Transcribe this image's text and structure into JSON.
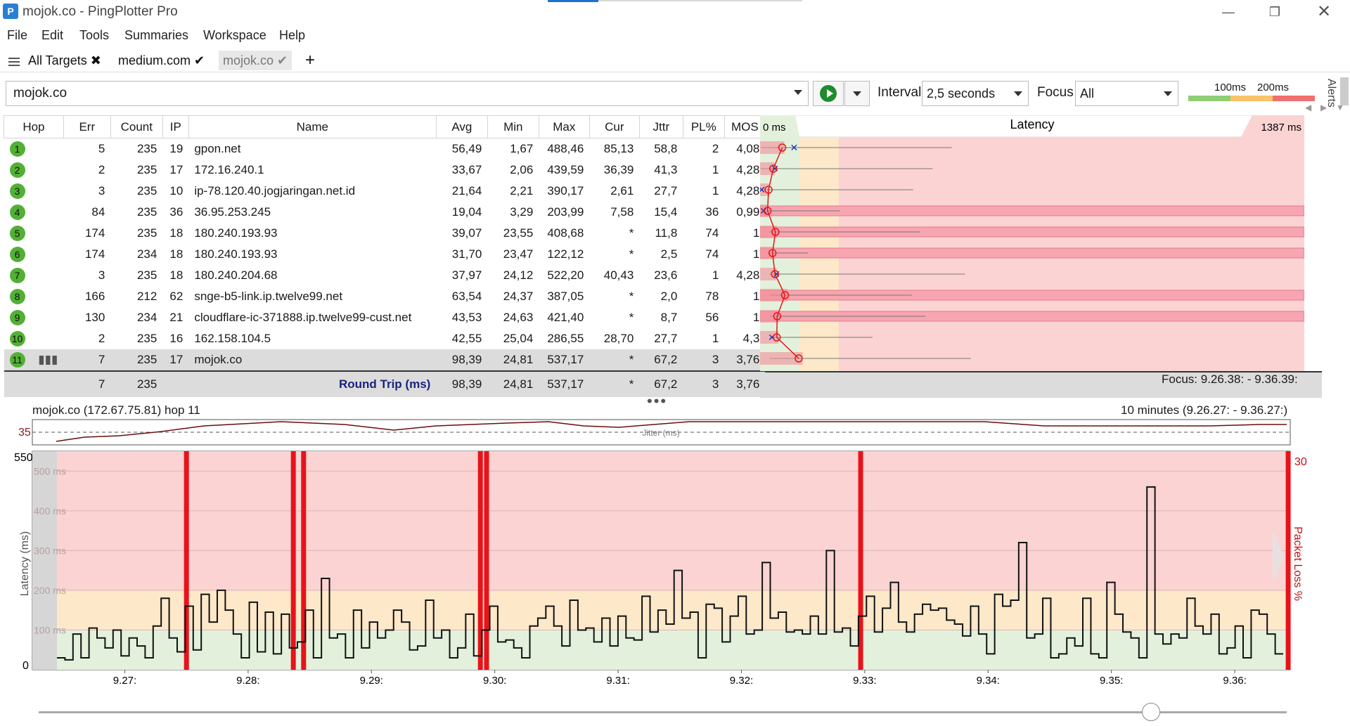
{
  "window": {
    "title": "mojok.co - PingPlotter Pro",
    "minimize_icon": "minimize-icon",
    "restore_icon": "restore-icon",
    "close_icon": "close-icon"
  },
  "menu": [
    "File",
    "Edit",
    "Tools",
    "Summaries",
    "Workspace",
    "Help"
  ],
  "tabs": [
    {
      "label": "All Targets",
      "icon": "close-x-icon"
    },
    {
      "label": "medium.com",
      "icon": "check-icon"
    },
    {
      "label": "mojok.co",
      "icon": "check-icon",
      "active": true
    }
  ],
  "toolbar": {
    "target_value": "mojok.co",
    "interval_label": "Interval",
    "interval_value": "2,5 seconds",
    "focus_label": "Focus",
    "focus_value": "All",
    "legend_100": "100ms",
    "legend_200": "200ms",
    "alerts_label": "Alerts",
    "colors": {
      "good": "#8fce74",
      "warn": "#f9c36b",
      "bad": "#f26f6f"
    }
  },
  "table": {
    "headers": [
      "Hop",
      "Err",
      "Count",
      "IP",
      "Name",
      "Avg",
      "Min",
      "Max",
      "Cur",
      "Jttr",
      "PL%",
      "MOS"
    ],
    "latency_header": "Latency",
    "latency_min_label": "0 ms",
    "latency_max_label": "1387 ms",
    "rows": [
      {
        "hop": "1",
        "err": "5",
        "count": "235",
        "ip": "19",
        "name": "gpon.net",
        "avg": "56,49",
        "min": "1,67",
        "max": "488,46",
        "cur": "85,13",
        "jttr": "58,8",
        "pl": "2",
        "mos": "4,08"
      },
      {
        "hop": "2",
        "err": "2",
        "count": "235",
        "ip": "17",
        "name": "172.16.240.1",
        "avg": "33,67",
        "min": "2,06",
        "max": "439,59",
        "cur": "36,39",
        "jttr": "41,3",
        "pl": "1",
        "mos": "4,28"
      },
      {
        "hop": "3",
        "err": "3",
        "count": "235",
        "ip": "10",
        "name": "ip-78.120.40.jogjaringan.net.id",
        "avg": "21,64",
        "min": "2,21",
        "max": "390,17",
        "cur": "2,61",
        "jttr": "27,7",
        "pl": "1",
        "mos": "4,28"
      },
      {
        "hop": "4",
        "err": "84",
        "count": "235",
        "ip": "36",
        "name": "36.95.253.245",
        "avg": "19,04",
        "min": "3,29",
        "max": "203,99",
        "cur": "7,58",
        "jttr": "15,4",
        "pl": "36",
        "mos": "0,99"
      },
      {
        "hop": "5",
        "err": "174",
        "count": "235",
        "ip": "18",
        "name": "180.240.193.93",
        "avg": "39,07",
        "min": "23,55",
        "max": "408,68",
        "cur": "*",
        "jttr": "11,8",
        "pl": "74",
        "mos": "1"
      },
      {
        "hop": "6",
        "err": "174",
        "count": "234",
        "ip": "18",
        "name": "180.240.193.93",
        "avg": "31,70",
        "min": "23,47",
        "max": "122,12",
        "cur": "*",
        "jttr": "2,5",
        "pl": "74",
        "mos": "1"
      },
      {
        "hop": "7",
        "err": "3",
        "count": "235",
        "ip": "18",
        "name": "180.240.204.68",
        "avg": "37,97",
        "min": "24,12",
        "max": "522,20",
        "cur": "40,43",
        "jttr": "23,6",
        "pl": "1",
        "mos": "4,28"
      },
      {
        "hop": "8",
        "err": "166",
        "count": "212",
        "ip": "62",
        "name": "snge-b5-link.ip.twelve99.net",
        "avg": "63,54",
        "min": "24,37",
        "max": "387,05",
        "cur": "*",
        "jttr": "2,0",
        "pl": "78",
        "mos": "1"
      },
      {
        "hop": "9",
        "err": "130",
        "count": "234",
        "ip": "21",
        "name": "cloudflare-ic-371888.ip.twelve99-cust.net",
        "avg": "43,53",
        "min": "24,63",
        "max": "421,40",
        "cur": "*",
        "jttr": "8,7",
        "pl": "56",
        "mos": "1"
      },
      {
        "hop": "10",
        "err": "2",
        "count": "235",
        "ip": "16",
        "name": "162.158.104.5",
        "avg": "42,55",
        "min": "25,04",
        "max": "286,55",
        "cur": "28,70",
        "jttr": "27,7",
        "pl": "1",
        "mos": "4,3"
      },
      {
        "hop": "11",
        "err": "7",
        "count": "235",
        "ip": "17",
        "name": "mojok.co",
        "avg": "98,39",
        "min": "24,81",
        "max": "537,17",
        "cur": "*",
        "jttr": "67,2",
        "pl": "3",
        "mos": "3,76",
        "selected": true,
        "icon": "bar-chart-icon"
      }
    ],
    "summary": {
      "err": "7",
      "count": "235",
      "name": "Round Trip (ms)",
      "avg": "98,39",
      "min": "24,81",
      "max": "537,17",
      "cur": "*",
      "jttr": "67,2",
      "pl": "3",
      "mos": "3,76",
      "focus": "Focus: 9.26.38: - 9.36.39:"
    }
  },
  "bottom": {
    "target_label": "mojok.co (172.67.75.81) hop 11",
    "range_label": "10 minutes (9.26.27: - 9.36.27:)",
    "jitter_label": "Jitter (ms)",
    "jitter_max": "35",
    "y_max": "550",
    "y_min": "0",
    "y_axis_label": "Latency (ms)",
    "right_axis_label": "Packet Loss %",
    "right_axis_max": "30",
    "band_labels": [
      "500 ms",
      "400 ms",
      "300 ms",
      "200 ms",
      "100 ms"
    ]
  },
  "chart_data": {
    "type": "line",
    "title": "",
    "xlabel": "",
    "ylabel": "Latency (ms)",
    "ylim": [
      0,
      550
    ],
    "x_ticks": [
      "9.27:",
      "9.28:",
      "9.29:",
      "9.30:",
      "9.31:",
      "9.32:",
      "9.33:",
      "9.34:",
      "9.35:",
      "9.36:"
    ],
    "y_ticks": [
      0,
      550
    ],
    "series": [
      {
        "values": [
          30,
          25,
          90,
          30,
          105,
          80,
          55,
          100,
          35,
          80,
          60,
          30,
          110,
          180,
          80,
          45,
          160,
          50,
          190,
          120,
          200,
          150,
          90,
          30,
          170,
          45,
          145,
          40,
          140,
          55,
          70,
          150,
          30,
          230,
          80,
          90,
          30,
          150,
          55,
          120,
          80,
          100,
          150,
          120,
          50,
          60,
          175,
          80,
          100,
          30,
          55,
          140,
          35,
          100,
          160,
          70,
          75,
          55,
          30,
          110,
          130,
          160,
          110,
          60,
          175,
          100,
          105,
          70,
          130,
          60,
          135,
          80,
          75,
          185,
          95,
          150,
          115,
          250,
          130,
          145,
          30,
          165,
          155,
          70,
          135,
          185,
          90,
          100,
          270,
          130,
          145,
          95,
          100,
          90,
          135,
          90,
          300,
          95,
          105,
          60,
          135,
          185,
          95,
          155,
          220,
          120,
          95,
          140,
          165,
          150,
          155,
          125,
          115,
          85,
          160,
          90,
          40,
          190,
          160,
          175,
          320,
          80,
          90,
          180,
          30,
          40,
          80,
          60,
          180,
          40,
          30,
          220,
          140,
          95,
          80,
          30,
          460,
          90,
          65,
          90,
          80,
          180,
          110,
          90,
          140,
          40,
          55,
          110,
          30,
          150,
          140,
          90,
          40
        ]
      }
    ],
    "packet_loss_x": [
      "9.27:30",
      "9.28:22",
      "9.28:27",
      "9.29:53",
      "9.29:56",
      "9.32:58",
      "9.36:26"
    ],
    "colors": {
      "band_good": "#e3f1dc",
      "band_warn": "#fde8c9",
      "band_bad": "#fbd3d3",
      "loss": "#e8131a",
      "line": "#111111"
    }
  }
}
